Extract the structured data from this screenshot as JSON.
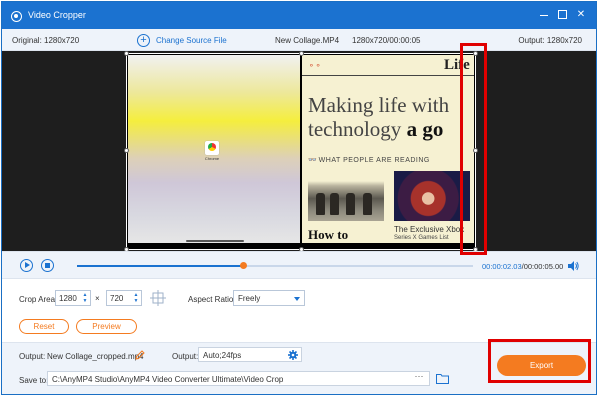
{
  "window": {
    "title": "Video Cropper"
  },
  "info": {
    "original": "Original: 1280x720",
    "change_source": "Change Source File",
    "file_name": "New Collage.MP4",
    "file_info": "1280x720/00:00:05",
    "output": "Output: 1280x720"
  },
  "preview_content": {
    "chrome_label": "Chrome",
    "brand": "Life",
    "headline1": "Making life with",
    "headline2_normal": "technology ",
    "headline2_bold": "a go",
    "tag_icon": "👓",
    "tag": "WHAT PEOPLE ARE READING",
    "how": "How to",
    "exclusive1": "The Exclusive Xbox",
    "exclusive2": "Series X Games List"
  },
  "playback": {
    "current_time": "00:00:02.03",
    "total_time": "/00:00:05.00",
    "progress": 0.42
  },
  "crop": {
    "label": "Crop Area:",
    "width": "1280",
    "times": "×",
    "height": "720",
    "aspect_label": "Aspect Ratio:",
    "aspect_value": "Freely",
    "reset": "Reset",
    "preview": "Preview"
  },
  "output": {
    "label": "Output:",
    "file_name": "New Collage_cropped.mp4",
    "label2": "Output:",
    "format": "Auto;24fps",
    "save_label": "Save to:",
    "path": "C:\\AnyMP4 Studio\\AnyMP4 Video Converter Ultimate\\Video Crop",
    "dots": "···",
    "export": "Export"
  },
  "colors": {
    "accent": "#1b72d0",
    "orange": "#f47b20",
    "highlight": "#e00000"
  }
}
